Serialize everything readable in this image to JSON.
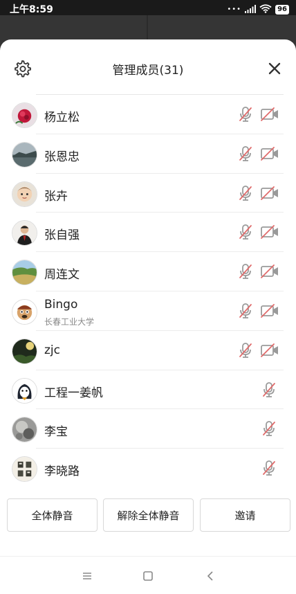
{
  "status_bar": {
    "time": "上午8:59",
    "signal_dots": "•••",
    "battery": "96"
  },
  "panel": {
    "title": "管理成员(31)",
    "settings_icon": "gear-icon",
    "close_icon": "close-icon"
  },
  "members": [
    {
      "name": "杨立松",
      "subtitle": ""
    },
    {
      "name": "张恩忠",
      "subtitle": ""
    },
    {
      "name": "张卉",
      "subtitle": ""
    },
    {
      "name": "张自强",
      "subtitle": ""
    },
    {
      "name": "周连文",
      "subtitle": ""
    },
    {
      "name": "Bingo",
      "subtitle": "长春工业大学"
    },
    {
      "name": "zjc",
      "subtitle": ""
    },
    {
      "name": "工程一姜帆",
      "subtitle": ""
    },
    {
      "name": "李宝",
      "subtitle": ""
    },
    {
      "name": "李晓路",
      "subtitle": ""
    }
  ],
  "buttons": {
    "mute_all": "全体静音",
    "unmute_all": "解除全体静音",
    "invite": "邀请"
  },
  "colors": {
    "muted_red": "#e06b6b",
    "icon_gray": "#9a9a9a"
  }
}
